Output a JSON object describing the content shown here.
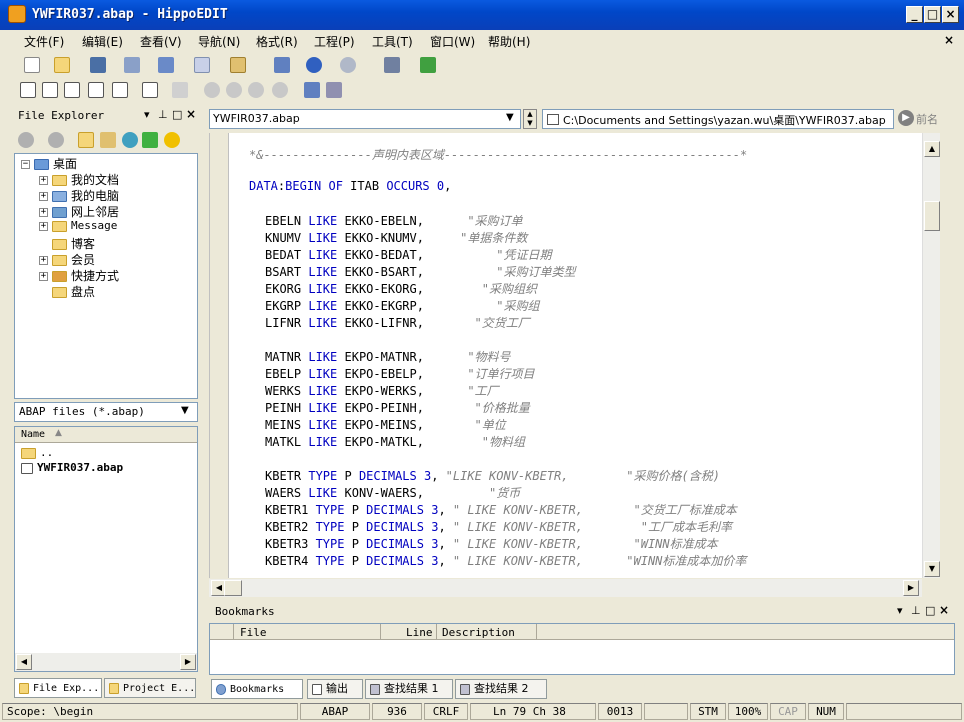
{
  "window": {
    "title": "YWFIR037.abap - HippoEDIT"
  },
  "menu": [
    "文件(F)",
    "编辑(E)",
    "查看(V)",
    "导航(N)",
    "格式(R)",
    "工程(P)",
    "工具(T)",
    "窗口(W)",
    "帮助(H)"
  ],
  "file_explorer": {
    "title": "File Explorer",
    "tree_root": "桌面",
    "tree_items": [
      "我的文档",
      "我的电脑",
      "网上邻居",
      "Message",
      "博客",
      "会员",
      "快捷方式",
      "盘点"
    ],
    "filter": "ABAP files (*.abap)",
    "column_name": "Name",
    "files": [
      "..",
      "YWFIR037.abap"
    ]
  },
  "left_tabs": [
    "File Exp...",
    "Project E..."
  ],
  "editor": {
    "doc_combo": "YWFIR037.abap",
    "path": "C:\\Documents and Settings\\yazan.wu\\桌面\\YWFIR037.abap",
    "forward_label": "前名",
    "code": [
      "*&---------------声明内表区域-----------------------------------------*",
      "DATA:BEGIN OF ITAB OCCURS 0,",
      "",
      "  EBELN LIKE EKKO-EBELN,      \"采购订单",
      "  KNUMV LIKE EKKO-KNUMV,     \"单据条件数",
      "  BEDAT LIKE EKKO-BEDAT,          \"凭证日期",
      "  BSART LIKE EKKO-BSART,          \"采购订单类型",
      "  EKORG LIKE EKKO-EKORG,        \"采购组织",
      "  EKGRP LIKE EKKO-EKGRP,          \"采购组",
      "  LIFNR LIKE EKKO-LIFNR,       \"交货工厂",
      "",
      "  MATNR LIKE EKPO-MATNR,      \"物料号",
      "  EBELP LIKE EKPO-EBELP,      \"订单行项目",
      "  WERKS LIKE EKPO-WERKS,      \"工厂",
      "  PEINH LIKE EKPO-PEINH,       \"价格批量",
      "  MEINS LIKE EKPO-MEINS,       \"单位",
      "  MATKL LIKE EKPO-MATKL,        \"物料组",
      "",
      "  KBETR TYPE P DECIMALS 3, \"LIKE KONV-KBETR,        \"采购价格(含税)",
      "  WAERS LIKE KONV-WAERS,         \"货币",
      "  KBETR1 TYPE P DECIMALS 3, \" LIKE KONV-KBETR,       \"交货工厂标准成本",
      "  KBETR2 TYPE P DECIMALS 3, \" LIKE KONV-KBETR,        \"工厂成本毛利率",
      "  KBETR3 TYPE P DECIMALS 3, \" LIKE KONV-KBETR,       \"WINN标准成本",
      "  KBETR4 TYPE P DECIMALS 3, \" LIKE KONV-KBETR,      \"WINN标准成本加价率"
    ]
  },
  "bookmarks": {
    "title": "Bookmarks",
    "columns": [
      "File",
      "Line",
      "Description"
    ]
  },
  "bottom_tabs": [
    "Bookmarks",
    "输出",
    "查找结果 1",
    "查找结果 2"
  ],
  "status": {
    "scope": "Scope: \\begin",
    "lang": "ABAP",
    "codepage": "936",
    "eol": "CRLF",
    "pos": "Ln  79 Ch  38",
    "char": "0013",
    "stm": "STM",
    "zoom": "100%",
    "cap": "CAP",
    "num": "NUM"
  }
}
